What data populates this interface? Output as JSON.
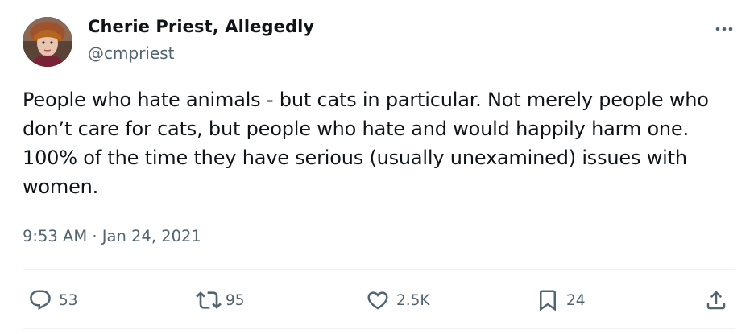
{
  "author": {
    "name": "Cherie Priest, Allegedly",
    "handle": "@cmpriest"
  },
  "tweet": {
    "text": "People who hate animals - but cats in particular. Not merely people who\ndon’t care for cats, but people who hate and would happily harm one.\n100% of the time they have serious (usually unexamined) issues with\nwomen.",
    "timestamp": "9:53 AM · Jan 24, 2021"
  },
  "actions": {
    "replies": "53",
    "retweets": "95",
    "likes": "2.5K",
    "bookmarks": "24"
  },
  "icons": {
    "more": "more-horizontal-icon",
    "reply": "reply-bubble-icon",
    "retweet": "retweet-icon",
    "like": "heart-icon",
    "bookmark": "bookmark-icon",
    "share": "share-upload-icon"
  },
  "colors": {
    "text": "#0f1419",
    "secondary": "#536471",
    "divider": "#eff3f4"
  }
}
